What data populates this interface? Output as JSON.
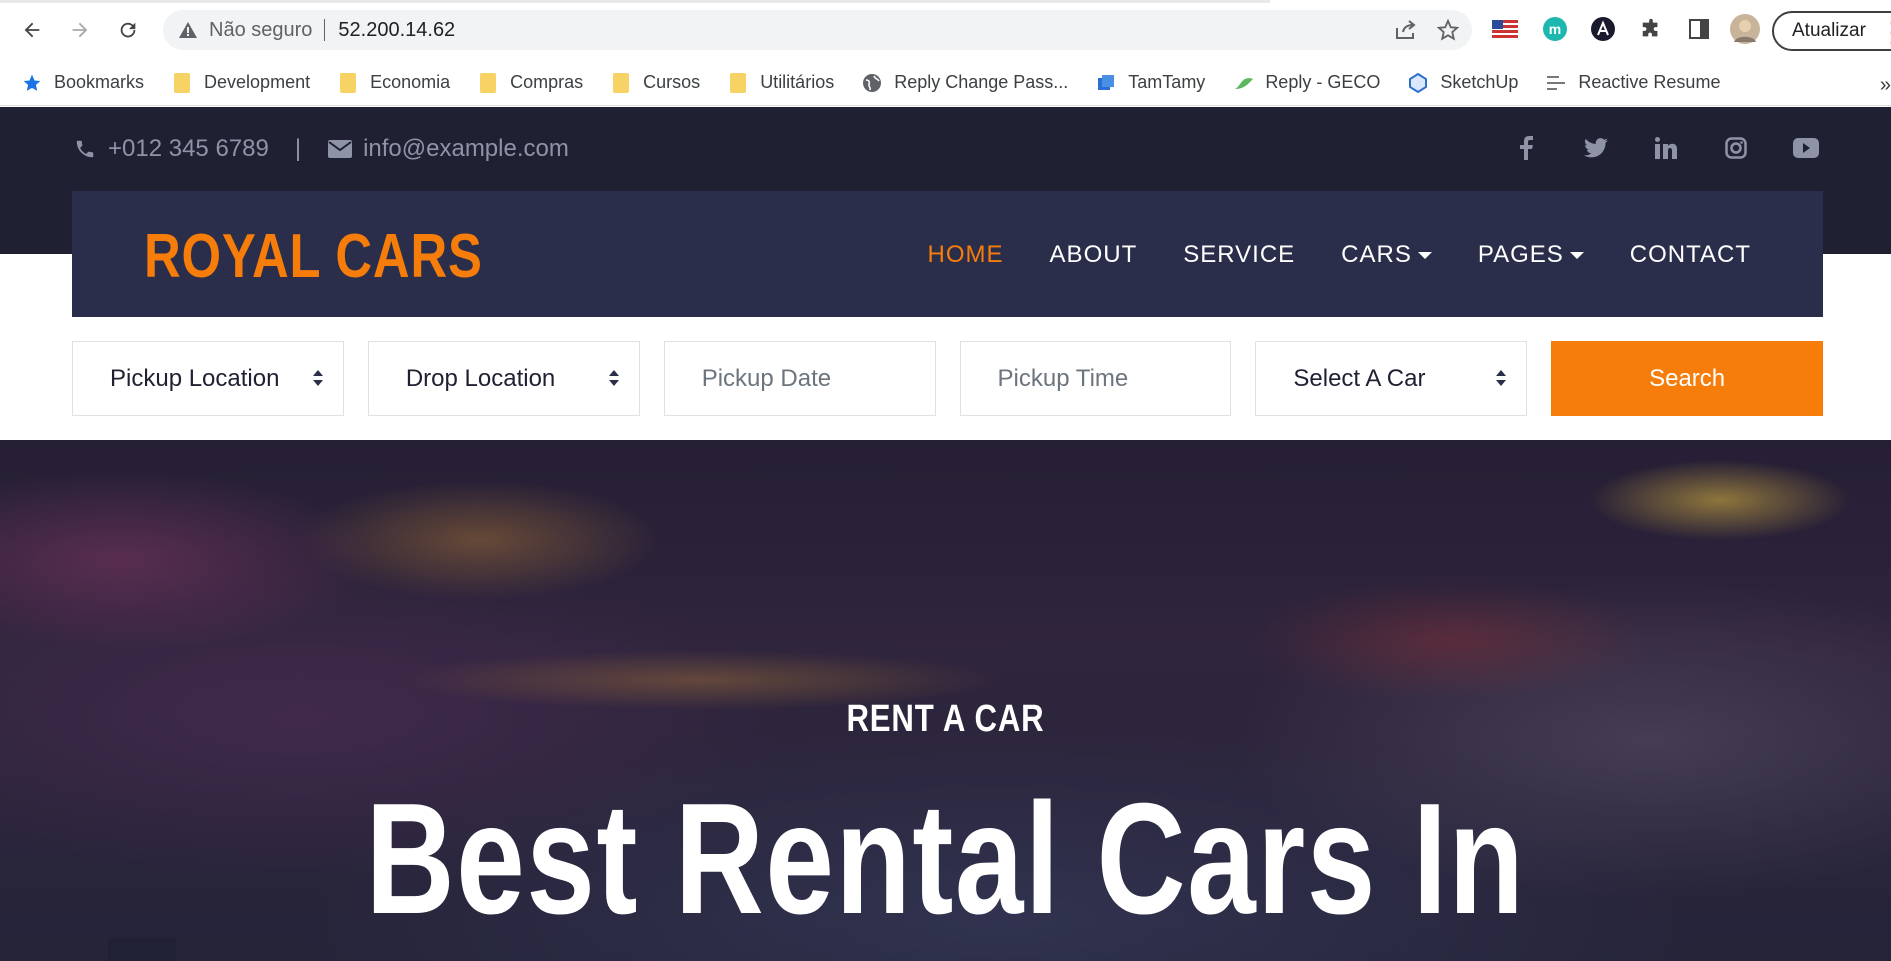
{
  "browser": {
    "security_label": "Não seguro",
    "url": "52.200.14.62",
    "update_label": "Atualizar",
    "bookmarks": [
      {
        "label": "Bookmarks",
        "icon": "star-icon"
      },
      {
        "label": "Development",
        "icon": "folder-icon"
      },
      {
        "label": "Economia",
        "icon": "folder-icon"
      },
      {
        "label": "Compras",
        "icon": "folder-icon"
      },
      {
        "label": "Cursos",
        "icon": "folder-icon"
      },
      {
        "label": "Utilitários",
        "icon": "folder-icon"
      },
      {
        "label": "Reply Change Pass...",
        "icon": "globe-icon"
      },
      {
        "label": "TamTamy",
        "icon": "tamtamy-icon"
      },
      {
        "label": "Reply - GECO",
        "icon": "geco-icon"
      },
      {
        "label": "SketchUp",
        "icon": "sketchup-icon"
      },
      {
        "label": "Reactive Resume",
        "icon": "resume-icon"
      }
    ],
    "more_label": "»"
  },
  "site": {
    "topbar": {
      "phone": "+012 345 6789",
      "divider": "|",
      "email": "info@example.com",
      "socials": [
        "facebook-icon",
        "twitter-icon",
        "linkedin-icon",
        "instagram-icon",
        "youtube-icon"
      ]
    },
    "brand": "ROYAL CARS",
    "nav": [
      {
        "label": "HOME",
        "active": true
      },
      {
        "label": "ABOUT"
      },
      {
        "label": "SERVICE"
      },
      {
        "label": "CARS",
        "dropdown": true
      },
      {
        "label": "PAGES",
        "dropdown": true
      },
      {
        "label": "CONTACT"
      }
    ],
    "search": {
      "pickup_location": "Pickup Location",
      "drop_location": "Drop Location",
      "pickup_date": "Pickup Date",
      "pickup_time": "Pickup Time",
      "select_car": "Select A Car",
      "button": "Search"
    },
    "hero": {
      "subtitle": "RENT A CAR",
      "title": "Best Rental Cars In"
    },
    "colors": {
      "accent": "#f77d0a",
      "dark": "#1f2133",
      "navbar": "#2b2e4a"
    }
  }
}
